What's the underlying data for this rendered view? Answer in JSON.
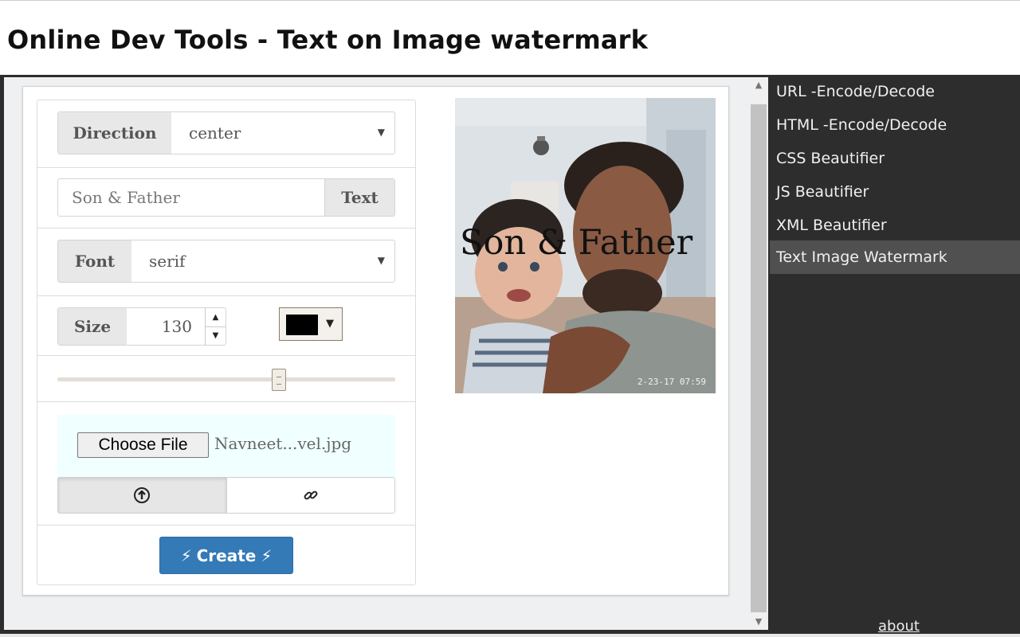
{
  "header": {
    "title": "Online Dev Tools - Text on Image watermark"
  },
  "form": {
    "direction": {
      "label": "Direction",
      "value": "center"
    },
    "text": {
      "value": "Son & Father",
      "button_label": "Text"
    },
    "font": {
      "label": "Font",
      "value": "serif"
    },
    "size": {
      "label": "Size",
      "value": "130"
    },
    "color": {
      "value": "#000000"
    },
    "opacity_slider": {
      "value_fraction": 0.66
    },
    "file": {
      "button_label": "Choose File",
      "file_name": "Navneet...vel.jpg"
    },
    "source_toggle": {
      "options": [
        "upload-icon",
        "link-icon"
      ],
      "selected": "upload-icon"
    },
    "create_button": {
      "label": "Create"
    }
  },
  "preview": {
    "watermark_text": "Son & Father",
    "timestamp": "2-23-17 07:59"
  },
  "sidebar": {
    "items": [
      {
        "label": "URL -Encode/Decode"
      },
      {
        "label": "HTML -Encode/Decode"
      },
      {
        "label": "CSS Beautifier"
      },
      {
        "label": "JS Beautifier"
      },
      {
        "label": "XML Beautifier"
      },
      {
        "label": "Text Image Watermark",
        "active": true
      }
    ],
    "about_label": "about"
  },
  "colors": {
    "accent": "#337ab7",
    "sidebar_bg": "#2d2d2d",
    "sidebar_active": "#505050"
  }
}
